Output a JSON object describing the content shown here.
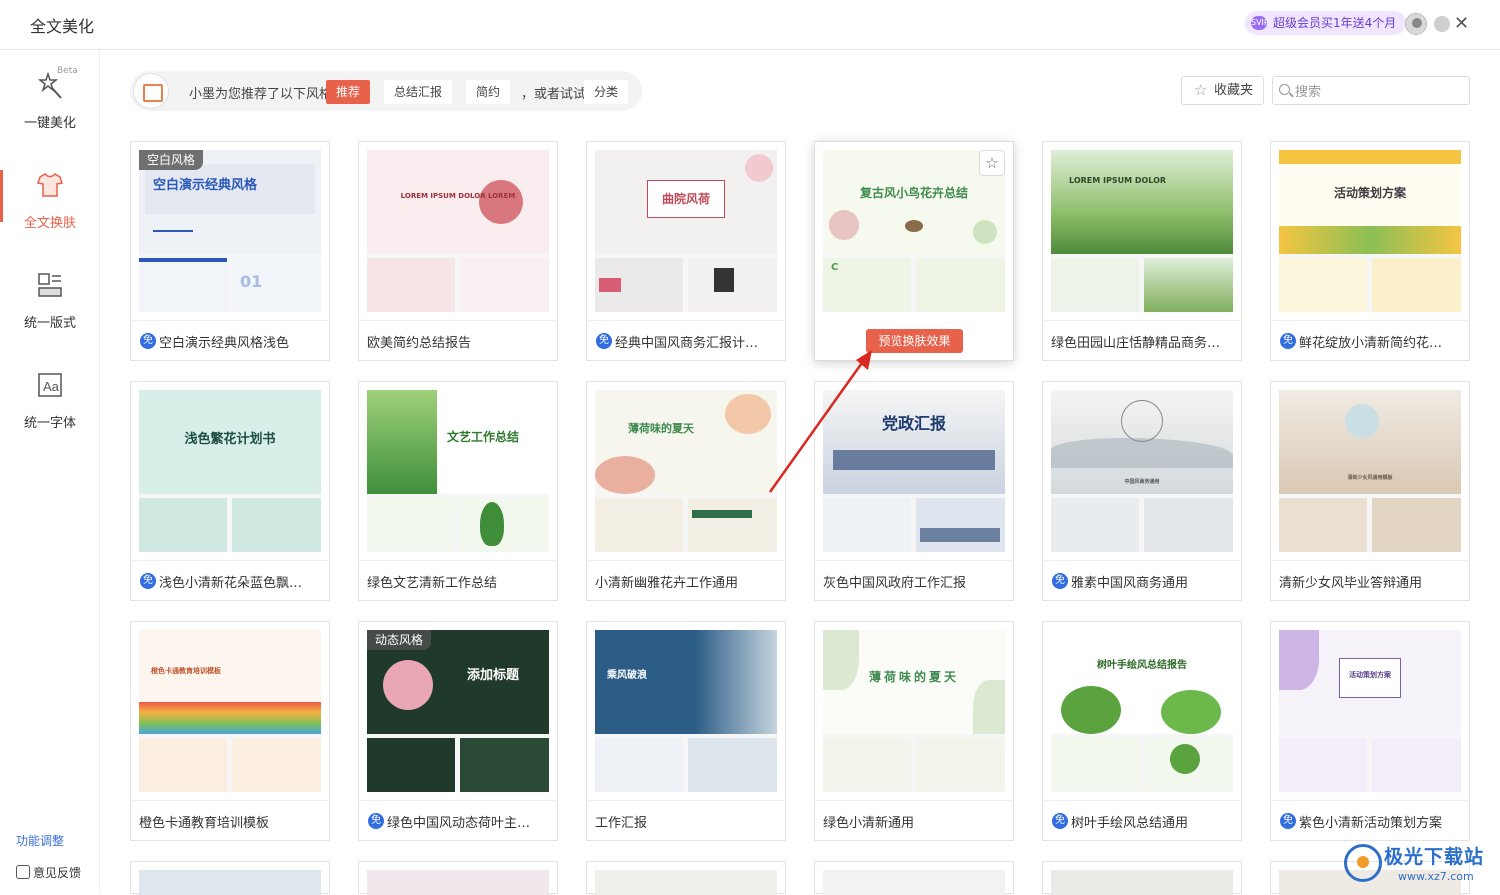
{
  "window": {
    "title": "全文美化"
  },
  "header": {
    "vip_label": "超级会员买1年送4个月",
    "vip_icon_text": "SVIP"
  },
  "sidebar": {
    "items": [
      {
        "label": "一键美化",
        "icon": "magic-wand-icon",
        "beta": "Beta"
      },
      {
        "label": "全文换肤",
        "icon": "tshirt-icon"
      },
      {
        "label": "统一版式",
        "icon": "layout-icon"
      },
      {
        "label": "统一字体",
        "icon": "font-icon"
      }
    ],
    "func_adjust": "功能调整",
    "feedback": "意见反馈"
  },
  "recommend": {
    "text": "小墨为您推荐了以下风格",
    "chips": [
      "推荐",
      "总结汇报",
      "简约"
    ],
    "or_text": "，或者试试",
    "category": "分类"
  },
  "toolbar": {
    "favorites": "收藏夹",
    "search_placeholder": "搜索"
  },
  "free_badge": "免",
  "preview_button": "预览换肤效果",
  "cards": [
    {
      "title": "空白演示经典风格浅色",
      "free": true,
      "tag": "空白风格",
      "hero_text": "空白演示经典风格"
    },
    {
      "title": "欧美简约总结报告",
      "free": false,
      "hero_text": "LOREM IPSUM DOLOR LOREM"
    },
    {
      "title": "经典中国风商务汇报计…",
      "free": true,
      "hero_text": "曲院风荷"
    },
    {
      "title": "",
      "free": false,
      "hero_text": "复古风小鸟花卉总结"
    },
    {
      "title": "绿色田园山庄恬静精品商务…",
      "free": false,
      "hero_text": "LOREM IPSUM DOLOR"
    },
    {
      "title": "鲜花绽放小清新简约花…",
      "free": true,
      "hero_text": "活动策划方案"
    },
    {
      "title": "浅色小清新花朵蓝色飘…",
      "free": true,
      "hero_text": "浅色繁花计划书"
    },
    {
      "title": "绿色文艺清新工作总结",
      "free": false,
      "hero_text": "文艺工作总结"
    },
    {
      "title": "小清新幽雅花卉工作通用",
      "free": false,
      "hero_text": "薄荷味的夏天"
    },
    {
      "title": "灰色中国风政府工作汇报",
      "free": false,
      "hero_text": "党政汇报"
    },
    {
      "title": "雅素中国风商务通用",
      "free": true,
      "hero_text": "中国风商务通用"
    },
    {
      "title": "清新少女风毕业答辩通用",
      "free": false,
      "hero_text": "清新少女风通用模板"
    },
    {
      "title": "橙色卡通教育培训模板",
      "free": false,
      "hero_text": "橙色卡通教育培训模板"
    },
    {
      "title": "绿色中国风动态荷叶主…",
      "free": true,
      "tag": "动态风格",
      "hero_text": "添加标题"
    },
    {
      "title": "工作汇报",
      "free": false,
      "hero_text": "乘风破浪"
    },
    {
      "title": "绿色小清新通用",
      "free": false,
      "hero_text": "薄荷味的夏天"
    },
    {
      "title": "树叶手绘风总结通用",
      "free": true,
      "hero_text": "树叶手绘风总结报告"
    },
    {
      "title": "紫色小清新活动策划方案",
      "free": true,
      "hero_text": "活动策划方案"
    }
  ],
  "watermark": {
    "title": "极光下载站",
    "url": "www.xz7.com"
  },
  "colors": {
    "accent": "#e8614a",
    "free_badge": "#2f6de0",
    "link": "#3a6fd8"
  }
}
